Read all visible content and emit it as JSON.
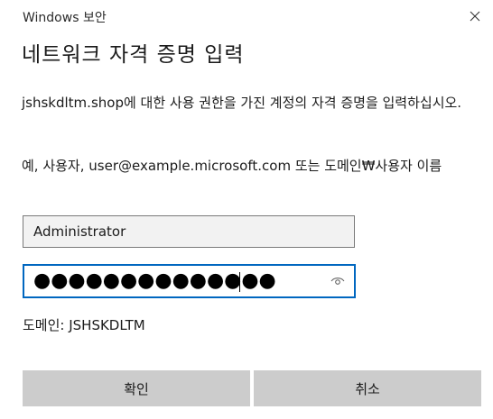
{
  "window": {
    "title": "Windows 보안"
  },
  "dialog": {
    "heading": "네트워크 자격 증명 입력",
    "description": "jshskdltm.shop에 대한 사용 권한을 가진 계정의 자격 증명을 입력하십시오.",
    "example": "예, 사용자, user@example.microsoft.com  또는  도메인₩사용자 이름"
  },
  "form": {
    "username_value": "Administrator",
    "password_masked": "●●●●●●●●●●●●●●",
    "domain_text": "도메인: JSHSKDLTM"
  },
  "buttons": {
    "ok_label": "확인",
    "cancel_label": "취소"
  },
  "icons": {
    "close": "close-icon",
    "reveal": "eye-icon"
  },
  "colors": {
    "focus_border": "#0067c0",
    "button_bg": "#cccccc",
    "input_bg": "#f2f2f2"
  }
}
